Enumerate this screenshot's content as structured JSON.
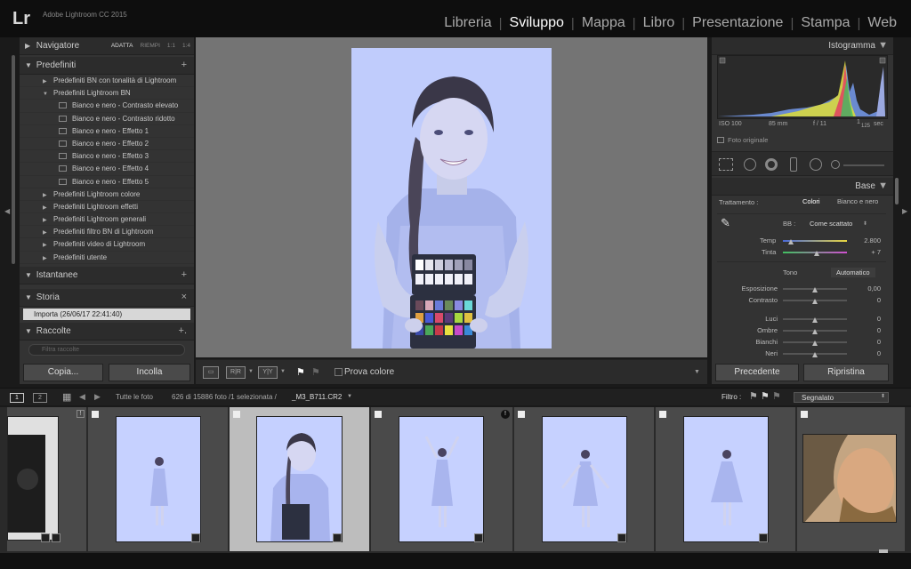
{
  "app": {
    "logo": "Lr",
    "title": "Adobe Lightroom CC 2015"
  },
  "modules": [
    {
      "label": "Libreria",
      "active": false
    },
    {
      "label": "Sviluppo",
      "active": true
    },
    {
      "label": "Mappa",
      "active": false
    },
    {
      "label": "Libro",
      "active": false
    },
    {
      "label": "Presentazione",
      "active": false
    },
    {
      "label": "Stampa",
      "active": false
    },
    {
      "label": "Web",
      "active": false
    }
  ],
  "left": {
    "navigator": {
      "title": "Navigatore",
      "opts": [
        "ADATTA",
        "RIEMPI",
        "1:1",
        "1:4"
      ]
    },
    "presets": {
      "title": "Predefiniti",
      "items": [
        {
          "label": "Predefiniti BN con tonalità di Lightroom",
          "level": 1,
          "open": false
        },
        {
          "label": "Predefiniti Lightroom BN",
          "level": 1,
          "open": true
        },
        {
          "label": "Bianco e nero - Contrasto elevato",
          "level": 2
        },
        {
          "label": "Bianco e nero - Contrasto ridotto",
          "level": 2
        },
        {
          "label": "Bianco e nero - Effetto 1",
          "level": 2
        },
        {
          "label": "Bianco e nero - Effetto 2",
          "level": 2
        },
        {
          "label": "Bianco e nero - Effetto 3",
          "level": 2
        },
        {
          "label": "Bianco e nero - Effetto 4",
          "level": 2
        },
        {
          "label": "Bianco e nero - Effetto 5",
          "level": 2
        },
        {
          "label": "Predefiniti Lightroom colore",
          "level": 1,
          "open": false
        },
        {
          "label": "Predefiniti Lightroom effetti",
          "level": 1,
          "open": false
        },
        {
          "label": "Predefiniti Lightroom generali",
          "level": 1,
          "open": false
        },
        {
          "label": "Predefiniti filtro BN di Lightroom",
          "level": 1,
          "open": false
        },
        {
          "label": "Predefiniti video di Lightroom",
          "level": 1,
          "open": false
        },
        {
          "label": "Predefiniti utente",
          "level": 1,
          "open": false
        }
      ]
    },
    "snapshots": {
      "title": "Istantanee"
    },
    "history": {
      "title": "Storia",
      "item": "Importa (26/06/17 22:41:40)"
    },
    "collections": {
      "title": "Raccolte",
      "filter_placeholder": "Filtra raccolte"
    },
    "copy": "Copia...",
    "paste": "Incolla"
  },
  "toolbar": {
    "before_after_1": "R|R",
    "before_after_2": "Y|Y",
    "soft_proof": "Prova colore"
  },
  "right": {
    "histogram_title": "Istogramma",
    "exif": {
      "iso": "ISO 100",
      "focal": "85 mm",
      "aperture": "f / 11",
      "shutter_num": "1",
      "shutter_den": "125",
      "shutter_unit": "sec"
    },
    "original": "Foto originale",
    "basic": {
      "title": "Base",
      "treatment_label": "Trattamento :",
      "treatment_color": "Colori",
      "treatment_bw": "Bianco e nero",
      "wb_label": "BB :",
      "wb_value": "Come scattato",
      "temp_label": "Temp",
      "temp_value": "2.800",
      "tint_label": "Tinta",
      "tint_value": "+ 7",
      "tone_label": "Tono",
      "auto_label": "Automatico",
      "sliders": [
        {
          "label": "Esposizione",
          "value": "0,00"
        },
        {
          "label": "Contrasto",
          "value": "0"
        },
        {
          "label": "Luci",
          "value": "0"
        },
        {
          "label": "Ombre",
          "value": "0"
        },
        {
          "label": "Bianchi",
          "value": "0"
        },
        {
          "label": "Neri",
          "value": "0"
        }
      ]
    },
    "previous": "Precedente",
    "reset": "Ripristina"
  },
  "filmstrip_bar": {
    "page1": "1",
    "page2": "2",
    "source": "Tutte le foto",
    "count": "626 di 15886 foto /1 selezionata /",
    "filename": "_M3_B711.CR2",
    "filter_label": "Filtro :",
    "filter_value": "Segnalato"
  },
  "colors": {
    "accent": "#ffffff",
    "panel": "#333333",
    "photo_tint": "#c7d3ff"
  }
}
